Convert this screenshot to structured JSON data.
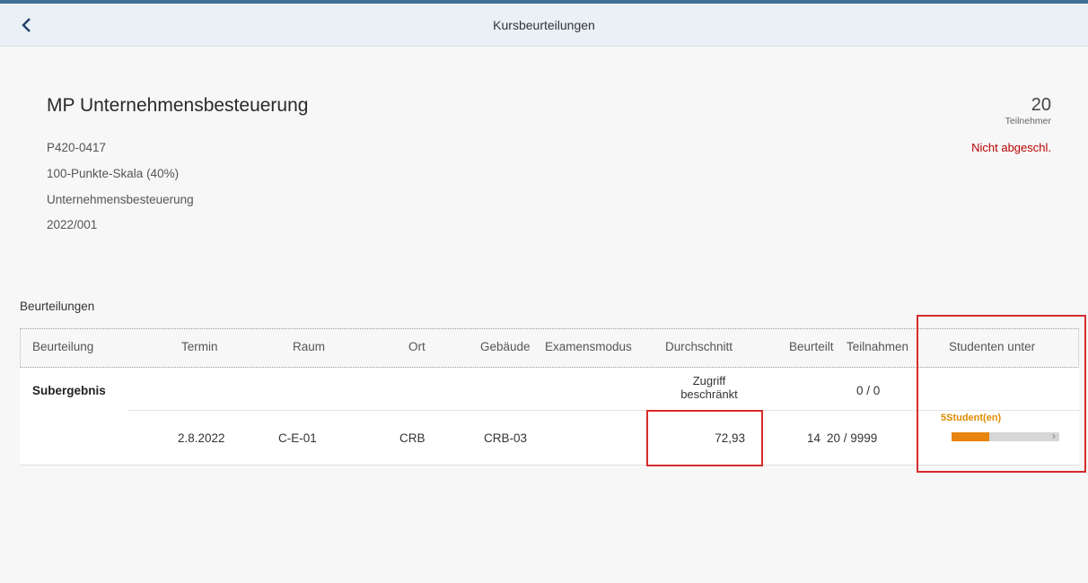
{
  "header": {
    "title": "Kursbeurteilungen",
    "back_icon": "chevron-left-icon"
  },
  "course": {
    "title": "MP Unternehmensbesteuerung",
    "code": "P420-0417",
    "scale": "100-Punkte-Skala (40%)",
    "subject": "Unternehmensbesteuerung",
    "period": "2022/001",
    "participants_count": "20",
    "participants_label": "Teilnehmer",
    "status": "Nicht abgeschl."
  },
  "section": {
    "title": "Beurteilungen"
  },
  "table": {
    "columns": {
      "beurteilung": "Beurteilung",
      "termin": "Termin",
      "raum": "Raum",
      "ort": "Ort",
      "gebaeude": "Gebäude",
      "examensmodus": "Examensmodus",
      "durchschnitt": "Durchschnitt",
      "beurteilt": "Beurteilt",
      "teilnahmen": "Teilnahmen",
      "studenten_unter": "Studenten unter"
    },
    "subresult": {
      "label": "Subergebnis",
      "durchschnitt_line1": "Zugriff",
      "durchschnitt_line2": "beschränkt",
      "teilnahmen": "0 / 0"
    },
    "row": {
      "termin": "2.8.2022",
      "raum": "C-E-01",
      "ort": "CRB",
      "gebaeude": "CRB-03",
      "durchschnitt": "72,93",
      "beurteilt": "14",
      "teilnahmen": "20 / 9999",
      "studenten_label": "5Student(en)",
      "studenten_fraction": 0.35
    }
  },
  "colors": {
    "accent_bar": "#3f6f96",
    "status": "#bb0000",
    "progress": "#e8850f",
    "highlight_box": "#d62b2b"
  }
}
